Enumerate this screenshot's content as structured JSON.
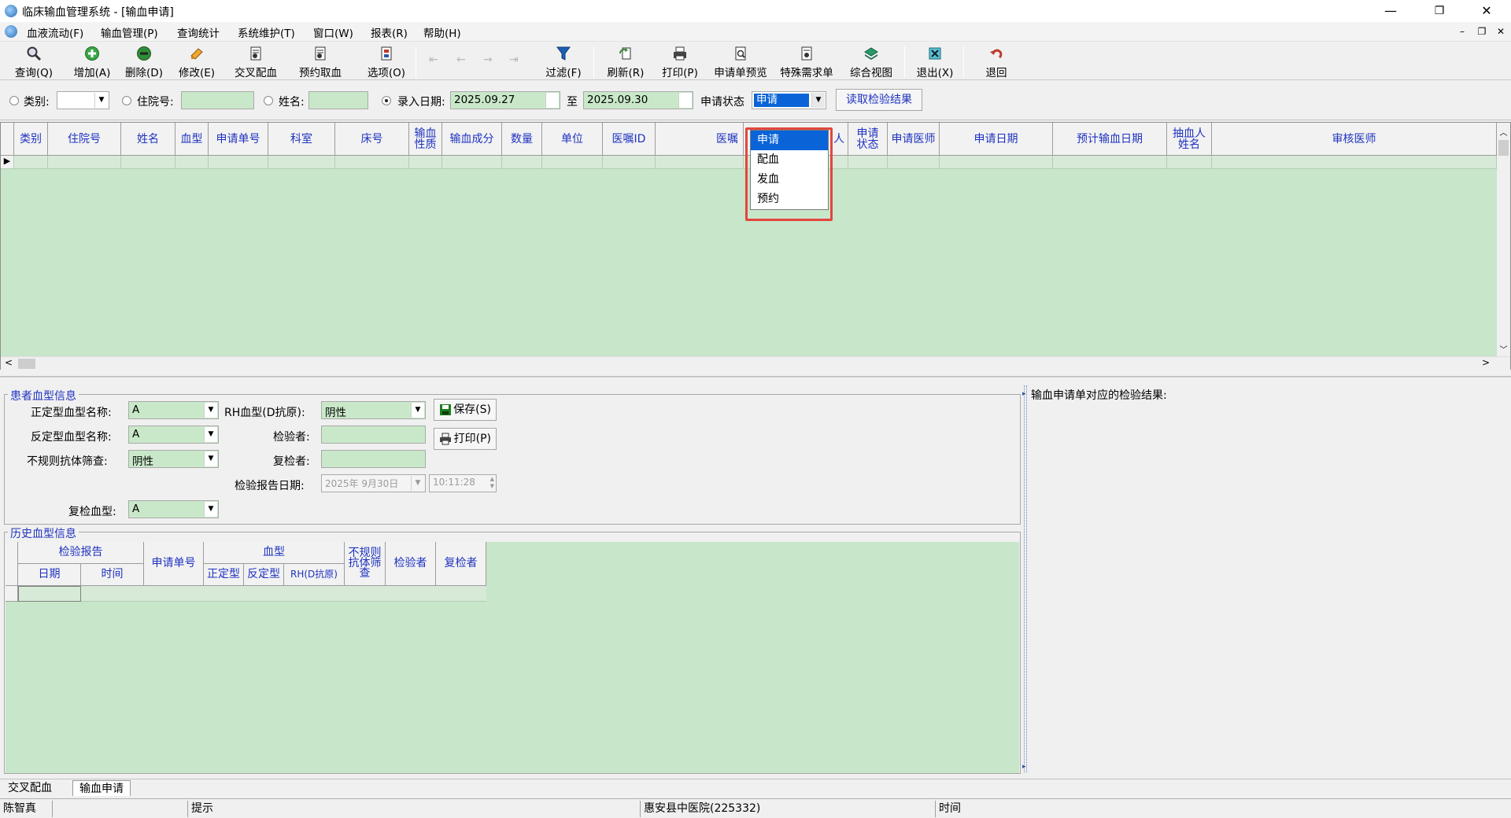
{
  "window": {
    "title": "临床输血管理系统 - [输血申请]",
    "minimize": "—",
    "restore": "❐",
    "close": "✕"
  },
  "menu": {
    "items": [
      "血液流动(F)",
      "输血管理(P)",
      "查询统计",
      "系统维护(T)",
      "窗口(W)",
      "报表(R)",
      "帮助(H)"
    ],
    "mdi_min": "–",
    "mdi_restore": "❐",
    "mdi_close": "✕"
  },
  "toolbar": {
    "buttons": [
      {
        "label": "查询(Q)",
        "icon": "magnifier-icon",
        "color": "#333333"
      },
      {
        "label": "增加(A)",
        "icon": "add-icon",
        "color": "#2e9e3a"
      },
      {
        "label": "删除(D)",
        "icon": "delete-icon",
        "color": "#2e7d32"
      },
      {
        "label": "修改(E)",
        "icon": "edit-icon",
        "color": "#f0a030"
      },
      {
        "label": "交叉配血",
        "icon": "document-icon",
        "color": "#555555"
      },
      {
        "label": "预约取血",
        "icon": "document-icon",
        "color": "#555555"
      },
      {
        "label": "选项(O)",
        "icon": "options-icon",
        "color": "#555555"
      },
      {
        "label": "过滤(F)",
        "icon": "filter-icon",
        "color": "#1e5fb4"
      },
      {
        "label": "刷新(R)",
        "icon": "refresh-icon",
        "color": "#3a8a3a"
      },
      {
        "label": "打印(P)",
        "icon": "printer-icon",
        "color": "#333333"
      },
      {
        "label": "申请单预览",
        "icon": "preview-icon",
        "color": "#555555"
      },
      {
        "label": "特殊需求单",
        "icon": "special-form-icon",
        "color": "#555555"
      },
      {
        "label": "综合视图",
        "icon": "book-icon",
        "color": "#2a9a6a"
      },
      {
        "label": "退出(X)",
        "icon": "exit-icon",
        "color": "#2a8a9a"
      },
      {
        "label": "退回",
        "icon": "return-icon",
        "color": "#c0392b"
      }
    ],
    "nav_arrows": [
      "⇤",
      "←",
      "→",
      "⇥"
    ]
  },
  "filter": {
    "category_label": "类别:",
    "category_value": "",
    "admission_label": "住院号:",
    "admission_value": "",
    "name_label": "姓名:",
    "name_value": "",
    "entry_date_label": "录入日期:",
    "date_from": "2025.09.27",
    "to_label": "至",
    "date_to": "2025.09.30",
    "status_label": "申请状态",
    "status_value": "申请",
    "read_button": "读取检验结果"
  },
  "grid": {
    "columns": [
      "类别",
      "住院号",
      "姓名",
      "血型",
      "申请单号",
      "科室",
      "床号",
      "输血性质",
      "输血成分",
      "数量",
      "单位",
      "医嘱ID",
      "医嘱",
      "人",
      "申请状态",
      "申请医师",
      "申请日期",
      "预计输血日期",
      "抽血人姓名",
      "审核医师"
    ],
    "row_marker": "▶"
  },
  "status_dropdown": {
    "options": [
      "申请",
      "配血",
      "发血",
      "预约"
    ],
    "selected": "申请",
    "highlight_color": "#e2463f"
  },
  "patient_blood": {
    "title": "患者血型信息",
    "forward_label": "正定型血型名称:",
    "forward_value": "A",
    "reverse_label": "反定型血型名称:",
    "reverse_value": "A",
    "antibody_label": "不规则抗体筛查:",
    "antibody_value": "阴性",
    "recheck_type_label": "复检血型:",
    "recheck_type_value": "A",
    "rh_label": "RH血型(D抗原):",
    "rh_value": "阴性",
    "inspector_label": "检验者:",
    "inspector_value": "",
    "rechecker_label": "复检者:",
    "rechecker_value": "",
    "report_date_label": "检验报告日期:",
    "report_date_value": "2025年 9月30日",
    "report_time_value": "10:11:28",
    "save_button": "保存(S)",
    "print_button": "打印(P)"
  },
  "history": {
    "title": "历史血型信息",
    "group_report": "检验报告",
    "col_date": "日期",
    "col_time": "时间",
    "col_apply_no": "申请单号",
    "group_blood": "血型",
    "col_forward": "正定型",
    "col_reverse": "反定型",
    "col_rh": "RH(D抗原)",
    "col_antibody": "不规则抗体筛查",
    "col_inspector": "检验者",
    "col_rechecker": "复检者"
  },
  "right_panel": {
    "title": "输血申请单对应的检验结果:"
  },
  "tabs": [
    "交叉配血",
    "输血申请"
  ],
  "active_tab": "输血申请",
  "statusbar": {
    "user": "陈智真",
    "hint": "提示",
    "hospital": "惠安县中医院(225332)",
    "time": "时间"
  }
}
